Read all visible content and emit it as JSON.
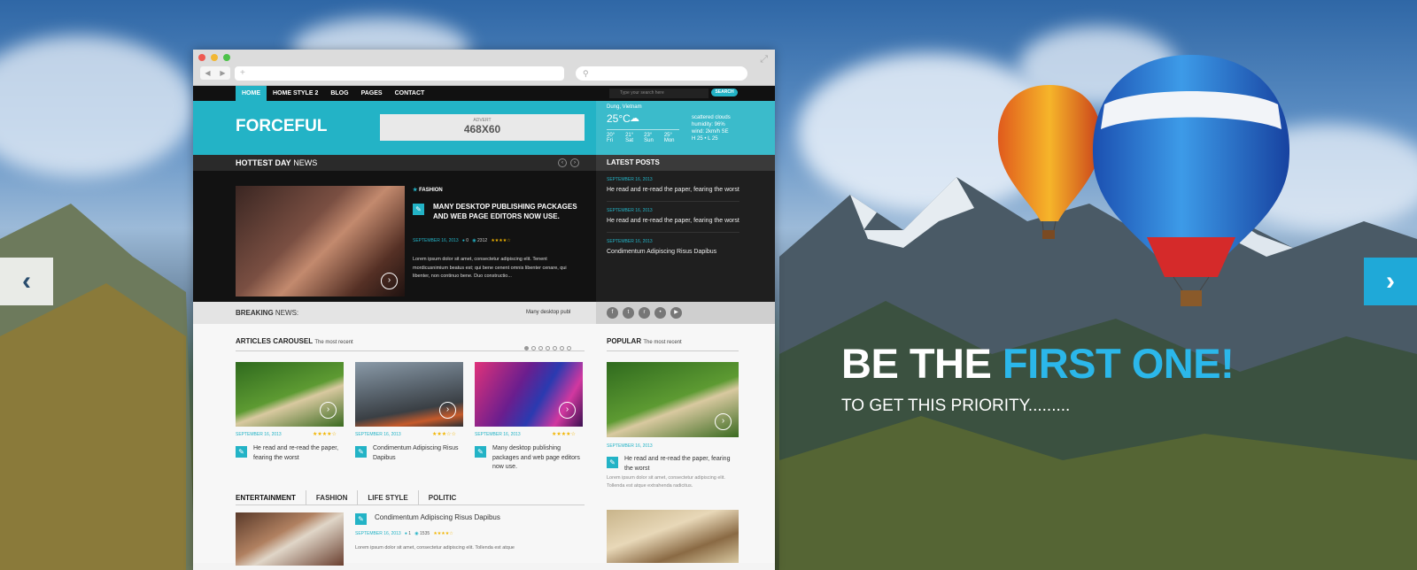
{
  "hero": {
    "headline_white": "BE THE",
    "headline_blue": "FIRST ONE!",
    "subheadline": "TO GET THIS PRIORITY.........",
    "prev_arrow": "‹",
    "next_arrow": "›",
    "accent_color": "#2bb7ea"
  },
  "browser": {
    "url_placeholder": "+",
    "search_icon": "search-icon"
  },
  "site": {
    "menu": [
      "HOME",
      "HOME STYLE 2",
      "BLOG",
      "PAGES",
      "CONTACT"
    ],
    "search_placeholder": "Type your search here",
    "search_button": "SEARCH",
    "logo": "FORCEFUL",
    "advert_label": "ADVERT",
    "advert_size": "468X60",
    "weather": {
      "location": "Dung, Vietnam",
      "temp": "25°C",
      "desc": "scattered clouds",
      "humidity": "humidity: 96%",
      "wind": "wind: 2km/h SE",
      "hl": "H 25 • L 25",
      "forecast": [
        {
          "t": "20°",
          "d": "Fri"
        },
        {
          "t": "21°",
          "d": "Sat"
        },
        {
          "t": "23°",
          "d": "Sun"
        },
        {
          "t": "25°",
          "d": "Mon"
        }
      ]
    },
    "hottest_bold": "HOTTEST DAY",
    "hottest_light": "NEWS",
    "featured": {
      "category": "FASHION",
      "title": "MANY DESKTOP PUBLISHING PACKAGES AND WEB PAGE EDITORS NOW USE.",
      "date": "SEPTEMBER 16, 2013",
      "comments": "0",
      "views": "2312",
      "stars": "★★★★☆",
      "excerpt": "Lorem ipsum dolor sit amet, consectetur adipiscing elit. Tenent mordicusnimium beatus est; qui bene cenent omnis libenter cenare, qui libenter, non continuo bene. Duo constructio..."
    },
    "latest_title": "LATEST POSTS",
    "latest": [
      {
        "date": "SEPTEMBER 16, 2013",
        "title": "He read and re-read the paper, fearing the worst"
      },
      {
        "date": "SEPTEMBER 16, 2013",
        "title": "He read and re-read the paper, fearing the worst"
      },
      {
        "date": "SEPTEMBER 16, 2013",
        "title": "Condimentum Adipiscing Risus Dapibus"
      }
    ],
    "breaking_bold": "BREAKING",
    "breaking_light": "NEWS:",
    "breaking_ticker": "Many desktop publ",
    "socials": [
      "f",
      "t",
      "r",
      "•",
      "▶"
    ],
    "carousel_bold": "ARTICLES CAROUSEL",
    "carousel_light": "The most recent",
    "carousel": [
      {
        "date": "SEPTEMBER 16, 2013",
        "stars": "★★★★☆",
        "title": "He read and re-read the paper, fearing the worst"
      },
      {
        "date": "SEPTEMBER 16, 2013",
        "stars": "★★★☆☆",
        "title": "Condimentum Adipiscing Risus Dapibus"
      },
      {
        "date": "SEPTEMBER 16, 2013",
        "stars": "★★★★☆",
        "title": "Many desktop publishing packages and web page editors now use."
      }
    ],
    "popular_bold": "POPULAR",
    "popular_light": "The most recent",
    "popular": {
      "date": "SEPTEMBER 16, 2013",
      "title": "He read and re-read the paper, fearing the worst",
      "excerpt": "Lorem ipsum dolor sit amet, consectetur adipiscing elit. Tollenda est atque extrahenda radicitus."
    },
    "tabs": [
      "ENTERTAINMENT",
      "FASHION",
      "LIFE STYLE",
      "POLITIC"
    ],
    "tab_article": {
      "title": "Condimentum Adipiscing Risus Dapibus",
      "date": "SEPTEMBER 16, 2013",
      "comments": "1",
      "views": "1535",
      "stars": "★★★★☆",
      "excerpt": "Lorem ipsum dolor sit amet, consectetur adipiscing elit. Tollenda est atque"
    }
  }
}
